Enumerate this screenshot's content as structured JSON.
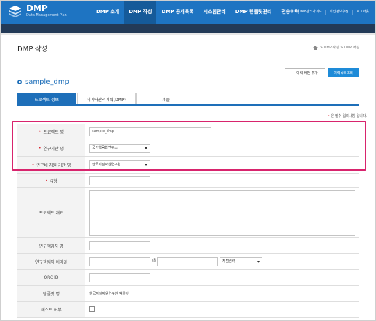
{
  "header": {
    "logo_title": "DMP",
    "logo_subtitle": "Data Management Plan",
    "nav": [
      "DMP 소개",
      "DMP 작성",
      "DMP 공개목록",
      "시스템관리",
      "DMP 템플릿관리",
      "전송이력"
    ],
    "active_nav": "DMP 작성",
    "util": [
      "DMP관리가이드",
      "개인정보수정",
      "로그아웃"
    ]
  },
  "page": {
    "title": "DMP 작성",
    "breadcrumb": [
      "DMP 작성",
      "DMP 작성"
    ]
  },
  "actions": {
    "add_version": "+ 이력 버전 추가",
    "history": "이력목록조회"
  },
  "dmp_name": "sample_dmp",
  "tabs": [
    "프로젝트 정보",
    "데이터관리계획(DMP)",
    "제출"
  ],
  "active_tab": "프로젝트 정보",
  "required_note": {
    "star": "•",
    "text": "은 필수 입력사항 입니다."
  },
  "form": {
    "project_name": {
      "label": "프로젝트 명",
      "required": "•",
      "value": "sample_dmp"
    },
    "research_org": {
      "label": "연구기관 명",
      "required": "•",
      "value": "국가핵융합연구소"
    },
    "funding_org": {
      "label": "연구비 지원 기관 명",
      "required": "•",
      "value": "한국지질자원연구원"
    },
    "type": {
      "label": "유형",
      "required": "•",
      "value": ""
    },
    "overview": {
      "label": "프로젝트 개요",
      "value": ""
    },
    "pi_name": {
      "label": "연구책임자 명",
      "value": ""
    },
    "pi_email": {
      "label": "연구책임자 이메일",
      "at": "@",
      "domain_select": "직접입력"
    },
    "orcid": {
      "label": "ORC ID",
      "value": ""
    },
    "template": {
      "label": "템플릿 명",
      "value": "한국지질자원연구원 템플릿"
    },
    "test": {
      "label": "테스트 여부"
    }
  },
  "colors": {
    "header": "#1e74c2",
    "accent": "#1e6fb9",
    "highlight": "#d8246d",
    "required": "#d9232e"
  }
}
